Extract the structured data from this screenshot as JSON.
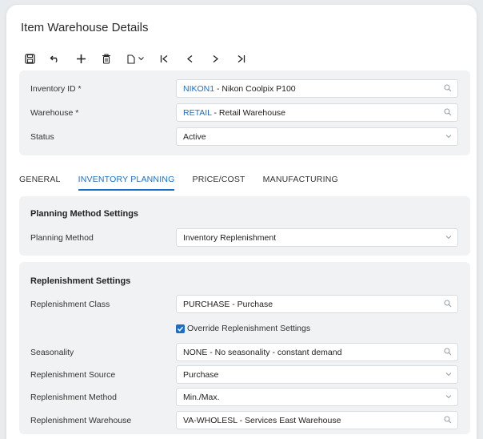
{
  "page": {
    "title": "Item Warehouse Details"
  },
  "toolbar": {
    "save": "save-icon",
    "undo": "undo-icon",
    "add": "add-icon",
    "delete": "delete-icon",
    "copy_paste": "copy-paste-icon",
    "first": "first-record-icon",
    "prev": "previous-record-icon",
    "next": "next-record-icon",
    "last": "last-record-icon"
  },
  "header": {
    "inventory_id": {
      "label": "Inventory ID *",
      "code": "NIKON1",
      "desc": " - Nikon Coolpix P100"
    },
    "warehouse": {
      "label": "Warehouse *",
      "code": "RETAIL",
      "desc": " - Retail Warehouse"
    },
    "status": {
      "label": "Status",
      "value": "Active"
    }
  },
  "tabs": [
    {
      "label": "GENERAL"
    },
    {
      "label": "INVENTORY PLANNING"
    },
    {
      "label": "PRICE/COST"
    },
    {
      "label": "MANUFACTURING"
    }
  ],
  "planning": {
    "title": "Planning Method Settings",
    "method_label": "Planning Method",
    "method_value": "Inventory Replenishment"
  },
  "replenishment": {
    "title": "Replenishment Settings",
    "class_label": "Replenishment Class",
    "class_value": "PURCHASE - Purchase",
    "override_label": "Override Replenishment Settings",
    "seasonality_label": "Seasonality",
    "seasonality_value": "NONE - No seasonality - constant demand",
    "source_label": "Replenishment Source",
    "source_value": "Purchase",
    "method_label": "Replenishment Method",
    "method_value": "Min./Max.",
    "warehouse_label": "Replenishment Warehouse",
    "warehouse_value": "VA-WHOLESL - Services East Warehouse"
  },
  "colors": {
    "accent": "#1a6fc7",
    "panel": "#f0f2f4"
  }
}
